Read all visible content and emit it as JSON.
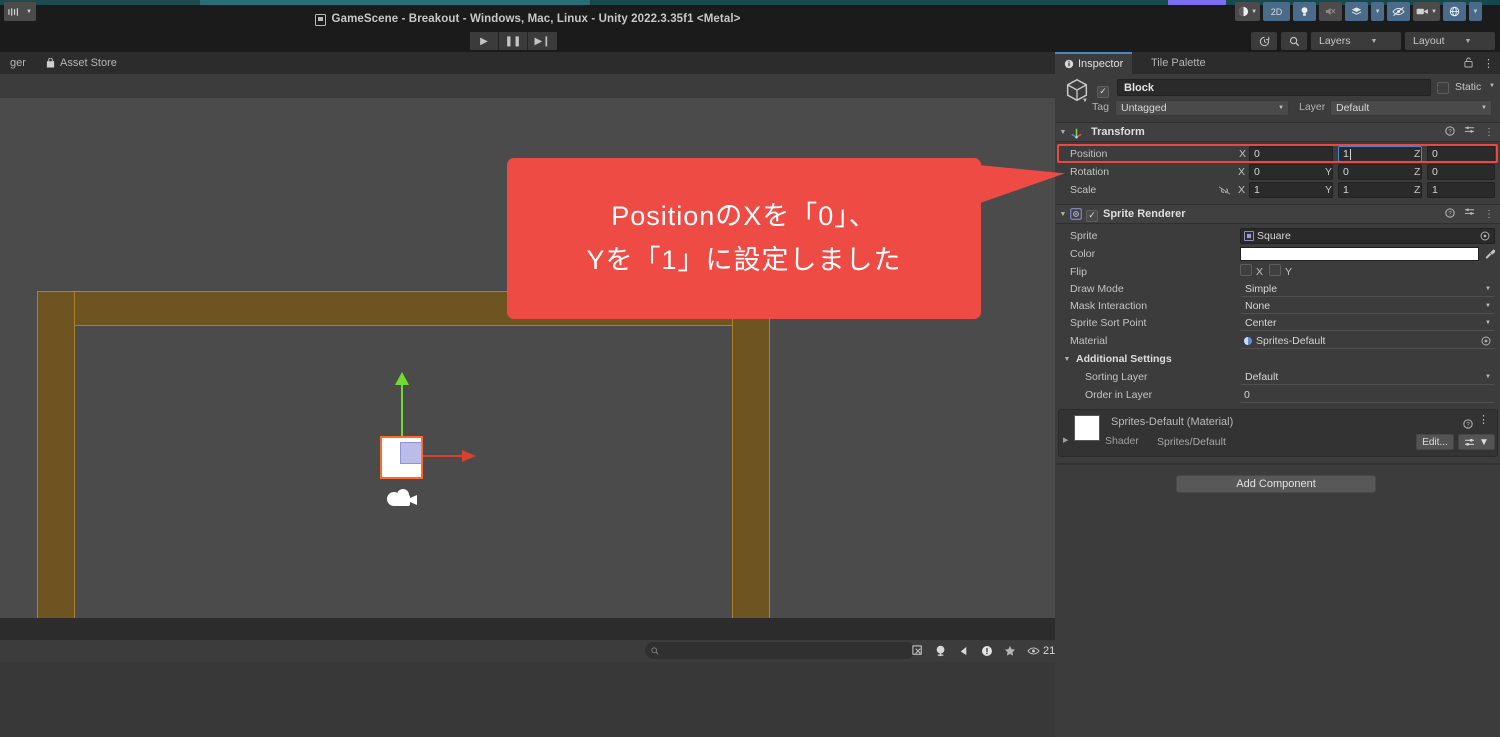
{
  "window": {
    "title": "GameScene - Breakout - Windows, Mac, Linux - Unity 2022.3.35f1 <Metal>",
    "title_icon": "unity-scene-icon"
  },
  "playbar": {
    "play": "▶",
    "pause": "❚❚",
    "step": "▶❙"
  },
  "toolbar_right": {
    "history_icon": "history-icon",
    "search_icon": "search-icon",
    "layers_label": "Layers",
    "layout_label": "Layout"
  },
  "left_tabs": [
    {
      "label": "ger",
      "icon": "",
      "active": false
    },
    {
      "label": "Asset Store",
      "icon": "store-icon",
      "active": false
    }
  ],
  "scene_toolbar": {
    "left_chip": "tool-handle-icon",
    "buttons": [
      {
        "name": "shading-mode",
        "label": "",
        "icon": "sphere-icon",
        "active": false
      },
      {
        "name": "toggle-2d",
        "label": "2D",
        "icon": "",
        "active": true
      },
      {
        "name": "toggle-lighting",
        "label": "",
        "icon": "light-bulb-icon",
        "active": true
      },
      {
        "name": "toggle-audio",
        "label": "",
        "icon": "speaker-mute-icon",
        "active": false
      },
      {
        "name": "fx-dropdown",
        "label": "",
        "icon": "fx-layers-icon",
        "active": true
      },
      {
        "name": "toggle-hidden",
        "label": "",
        "icon": "eye-slash-icon",
        "active": true
      },
      {
        "name": "camera-dropdown",
        "label": "",
        "icon": "camera-icon",
        "active": false
      },
      {
        "name": "gizmos-dropdown",
        "label": "",
        "icon": "gizmo-globe-icon",
        "active": true
      }
    ]
  },
  "scene": {
    "objects": [
      {
        "name": "block",
        "type": "selected-sprite"
      },
      {
        "name": "ball",
        "type": "circle-sprite"
      },
      {
        "name": "paddle",
        "type": "rect-sprite"
      },
      {
        "name": "camera-gizmo",
        "type": "camera-icon"
      }
    ],
    "gizmo_y_color": "#6fdb2f",
    "gizmo_x_color": "#d9412f",
    "selection_outline_color": "#ff6a2b",
    "wall_color": "#6e5420",
    "background_color": "#4b4b4b"
  },
  "callout": {
    "line1": "PositionのXを「0」、",
    "line2": "Yを「1」に設定しました",
    "color": "#ef4b45"
  },
  "console": {
    "search_placeholder": "",
    "search_icon": "search-icon",
    "buttons": [
      {
        "name": "console-clear",
        "icon": "clear-icon",
        "label": ""
      },
      {
        "name": "console-collapse",
        "icon": "collapse-icon",
        "label": ""
      },
      {
        "name": "console-errorpause",
        "icon": "pause-icon",
        "label": ""
      },
      {
        "name": "console-log",
        "icon": "info-icon",
        "label": ""
      },
      {
        "name": "console-favorite",
        "icon": "star-icon",
        "label": ""
      }
    ],
    "count_icon": "eye-icon",
    "count": "21",
    "lock_icon": "lock-open-icon",
    "kebab_icon": "kebab-menu-icon"
  },
  "inspector": {
    "tabs": [
      {
        "label": "Inspector",
        "icon": "info-icon",
        "active": true
      },
      {
        "label": "Tile Palette",
        "icon": "",
        "active": false
      }
    ],
    "lock_icon": "lock-open-icon",
    "kebab_icon": "kebab-menu-icon",
    "object": {
      "enabled": true,
      "name": "Block",
      "static_label": "Static",
      "tag_label": "Tag",
      "tag_value": "Untagged",
      "layer_label": "Layer",
      "layer_value": "Default",
      "icon": "cube-icon"
    },
    "transform": {
      "title": "Transform",
      "icon": "transform-axes-icon",
      "rows": [
        {
          "label": "Position",
          "x": "0",
          "y": "1",
          "z": "0",
          "highlighted": true,
          "focused_axis": "Y"
        },
        {
          "label": "Rotation",
          "x": "0",
          "y": "0",
          "z": "0",
          "highlighted": false,
          "focused_axis": ""
        },
        {
          "label": "Scale",
          "x": "1",
          "y": "1",
          "z": "1",
          "highlighted": false,
          "focused_axis": "",
          "link_icon": "chain-broken-icon"
        }
      ]
    },
    "sprite_renderer": {
      "title": "Sprite Renderer",
      "icon": "sprite-renderer-icon",
      "enabled": true,
      "fields": [
        {
          "label": "Sprite",
          "value": "Square",
          "type": "object-field",
          "icon": "sprite-icon"
        },
        {
          "label": "Color",
          "value": "#FFFFFF",
          "type": "color-field",
          "eyedropper": "eyedropper-icon"
        },
        {
          "label": "Flip",
          "value": "",
          "type": "flip-field",
          "x_label": "X",
          "y_label": "Y"
        },
        {
          "label": "Draw Mode",
          "value": "Simple",
          "type": "dropdown"
        },
        {
          "label": "Mask Interaction",
          "value": "None",
          "type": "dropdown"
        },
        {
          "label": "Sprite Sort Point",
          "value": "Center",
          "type": "dropdown"
        },
        {
          "label": "Material",
          "value": "Sprites-Default",
          "type": "object-field",
          "icon": "material-icon"
        }
      ],
      "additional_settings": {
        "title": "Additional Settings",
        "fields": [
          {
            "label": "Sorting Layer",
            "value": "Default",
            "type": "dropdown"
          },
          {
            "label": "Order in Layer",
            "value": "0",
            "type": "number"
          }
        ]
      }
    },
    "material_preview": {
      "title": "Sprites-Default (Material)",
      "shader_label": "Shader",
      "shader_value": "Sprites/Default",
      "edit_label": "Edit...",
      "help_icon": "help-icon",
      "kebab_icon": "kebab-menu-icon"
    },
    "add_component_label": "Add Component"
  }
}
